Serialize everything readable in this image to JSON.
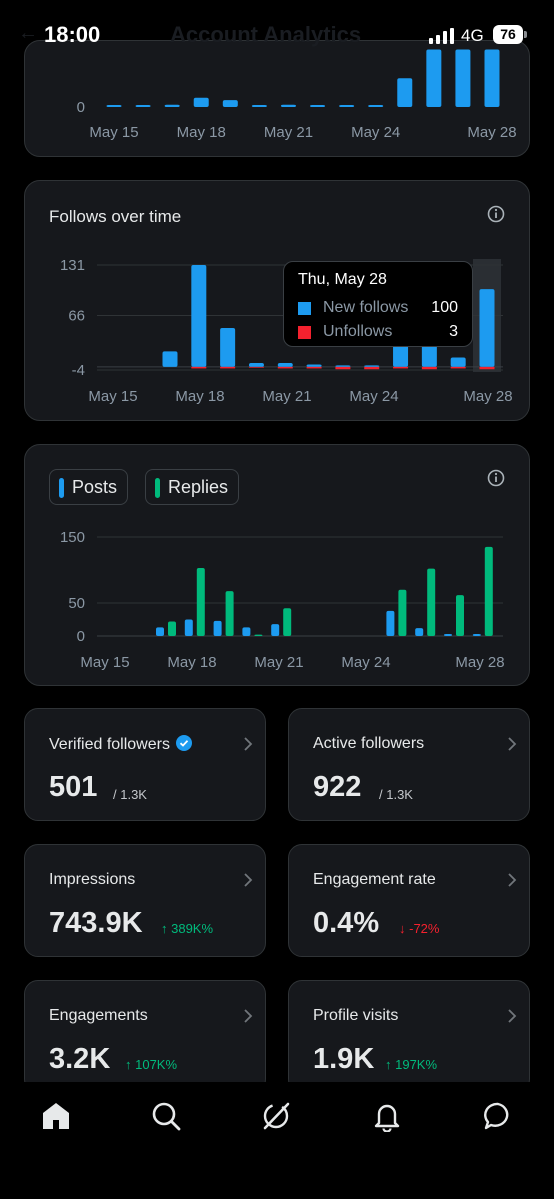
{
  "status_bar": {
    "time": "18:00",
    "network": "4G",
    "battery": "76",
    "obscured_title": "Account Analytics"
  },
  "chart_top": {
    "x_tick_labels": [
      "May 15",
      "May 18",
      "May 21",
      "May 24",
      "May 28"
    ],
    "y_tick_labels": [
      "0"
    ]
  },
  "follows_card": {
    "title": "Follows over time",
    "info_icon": "info-icon"
  },
  "tooltip": {
    "date": "Thu, May 28",
    "rows": [
      {
        "label": "New follows",
        "value": "100",
        "color": "#1d9bf0"
      },
      {
        "label": "Unfollows",
        "value": "3",
        "color": "#f4212e"
      }
    ]
  },
  "posts_card": {
    "legend": [
      {
        "label": "Posts",
        "color": "#1d9bf0"
      },
      {
        "label": "Replies",
        "color": "#00ba7c"
      }
    ],
    "info_icon": "info-icon"
  },
  "chart_data": [
    {
      "type": "bar",
      "x": [
        "May 15",
        "May 16",
        "May 17",
        "May 18",
        "May 19",
        "May 20",
        "May 21",
        "May 22",
        "May 23",
        "May 24",
        "May 25",
        "May 26",
        "May 27",
        "May 28"
      ],
      "x_tick_labels": [
        "May 15",
        "May 18",
        "May 21",
        "May 24",
        "May 28"
      ],
      "y_tick_labels": [
        "0"
      ],
      "series": [
        {
          "values": [
            1,
            1,
            2,
            8,
            6,
            1,
            2,
            1,
            1,
            1,
            25,
            50,
            50,
            50
          ],
          "color": "#1d9bf0"
        }
      ],
      "ylim": [
        -4,
        50
      ]
    },
    {
      "type": "bar",
      "title": "Follows over time",
      "x": [
        "May 15",
        "May 16",
        "May 17",
        "May 18",
        "May 19",
        "May 20",
        "May 21",
        "May 22",
        "May 23",
        "May 24",
        "May 25",
        "May 26",
        "May 27",
        "May 28"
      ],
      "x_tick_labels": [
        "May 15",
        "May 18",
        "May 21",
        "May 24",
        "May 28"
      ],
      "y_tick_labels": [
        "131",
        "66",
        "-4"
      ],
      "ylim": [
        -4,
        131
      ],
      "series": [
        {
          "name": "New follows",
          "color": "#1d9bf0",
          "values": [
            0,
            0,
            20,
            131,
            50,
            5,
            5,
            3,
            2,
            2,
            30,
            40,
            12,
            100
          ]
        },
        {
          "name": "Unfollows",
          "color": "#f4212e",
          "values": [
            0,
            0,
            0,
            2,
            2,
            1,
            2,
            2,
            3,
            3,
            2,
            3,
            2,
            3
          ]
        }
      ],
      "highlight": {
        "x": "May 28",
        "new_follows": 100,
        "unfollows": 3
      }
    },
    {
      "type": "bar",
      "x": [
        "May 15",
        "May 16",
        "May 17",
        "May 18",
        "May 19",
        "May 20",
        "May 21",
        "May 22",
        "May 23",
        "May 24",
        "May 25",
        "May 26",
        "May 27",
        "May 28"
      ],
      "x_tick_labels": [
        "May 15",
        "May 18",
        "May 21",
        "May 24",
        "May 28"
      ],
      "y_tick_labels": [
        "150",
        "50",
        "0"
      ],
      "ylim": [
        0,
        150
      ],
      "series": [
        {
          "name": "Posts",
          "color": "#1d9bf0",
          "values": [
            0,
            0,
            13,
            25,
            23,
            13,
            18,
            0,
            0,
            0,
            38,
            12,
            3,
            3
          ]
        },
        {
          "name": "Replies",
          "color": "#00ba7c",
          "values": [
            0,
            0,
            22,
            103,
            68,
            2,
            42,
            0,
            0,
            0,
            70,
            102,
            62,
            135
          ]
        }
      ]
    }
  ],
  "stats": [
    {
      "label": "Verified followers",
      "value": "501",
      "sub": "/ 1.3K",
      "verified": true
    },
    {
      "label": "Active followers",
      "value": "922",
      "sub": "/ 1.3K"
    },
    {
      "label": "Impressions",
      "value": "743.9K",
      "delta": "↑ 389K%",
      "trend": "up"
    },
    {
      "label": "Engagement rate",
      "value": "0.4%",
      "delta": "↓ -72%",
      "trend": "down"
    },
    {
      "label": "Engagements",
      "value": "3.2K",
      "delta": "↑ 107K%",
      "trend": "up"
    },
    {
      "label": "Profile visits",
      "value": "1.9K",
      "delta": "↑ 197K%",
      "trend": "up"
    }
  ],
  "bottom_nav": [
    {
      "icon": "home-icon"
    },
    {
      "icon": "search-icon"
    },
    {
      "icon": "grok-icon"
    },
    {
      "icon": "notifications-icon"
    },
    {
      "icon": "messages-icon"
    }
  ],
  "colors": {
    "background": "#000000",
    "card": "#16181c",
    "border": "#2f3336",
    "blue": "#1d9bf0",
    "green": "#00ba7c",
    "red": "#f4212e"
  }
}
